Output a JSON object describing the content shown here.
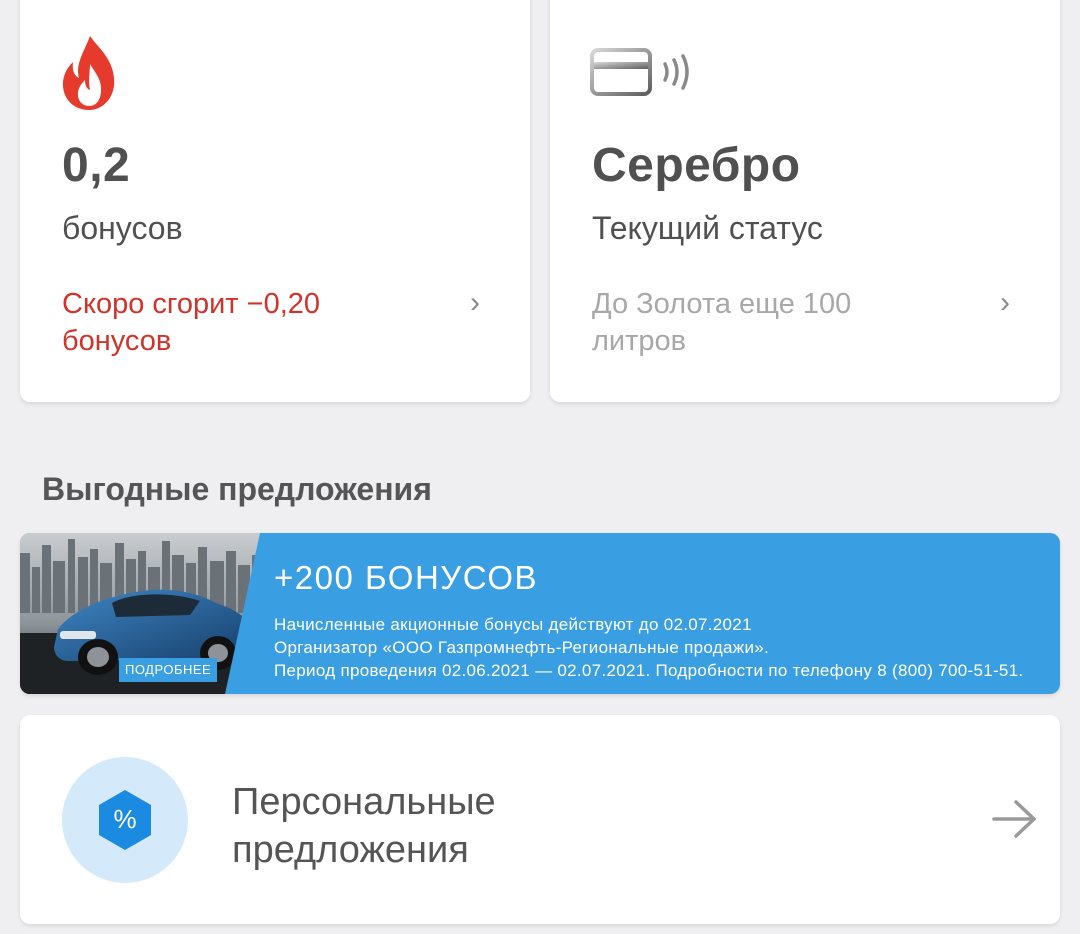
{
  "bonus_card": {
    "icon": "flame-icon",
    "value": "0,2",
    "label": "бонусов",
    "expiry_note": "Скоро сгорит −0,20 бонусов",
    "accent_color": "#d1322a"
  },
  "status_card": {
    "icon": "contactless-card-icon",
    "value": "Серебро",
    "label": "Текущий статус",
    "progress_note": "До Золота еще 100 литров"
  },
  "offers_section": {
    "title": "Выгодные предложения"
  },
  "promo_banner": {
    "title": "+200 БОНУСОВ",
    "line1": "Начисленные акционные бонусы действуют до 02.07.2021",
    "line2": "Организатор «ООО Газпромнефть-Региональные продажи».",
    "line3": "Период проведения 02.06.2021 — 02.07.2021. Подробности по телефону 8 (800) 700-51-51.",
    "more_label": "ПОДРОБНЕЕ",
    "background_color": "#3a9ee2"
  },
  "personal_offers": {
    "icon": "percent-hexagon-icon",
    "label": "Персональные предложения",
    "arrow_icon": "arrow-right-icon",
    "icon_color": "#1a8be0"
  }
}
